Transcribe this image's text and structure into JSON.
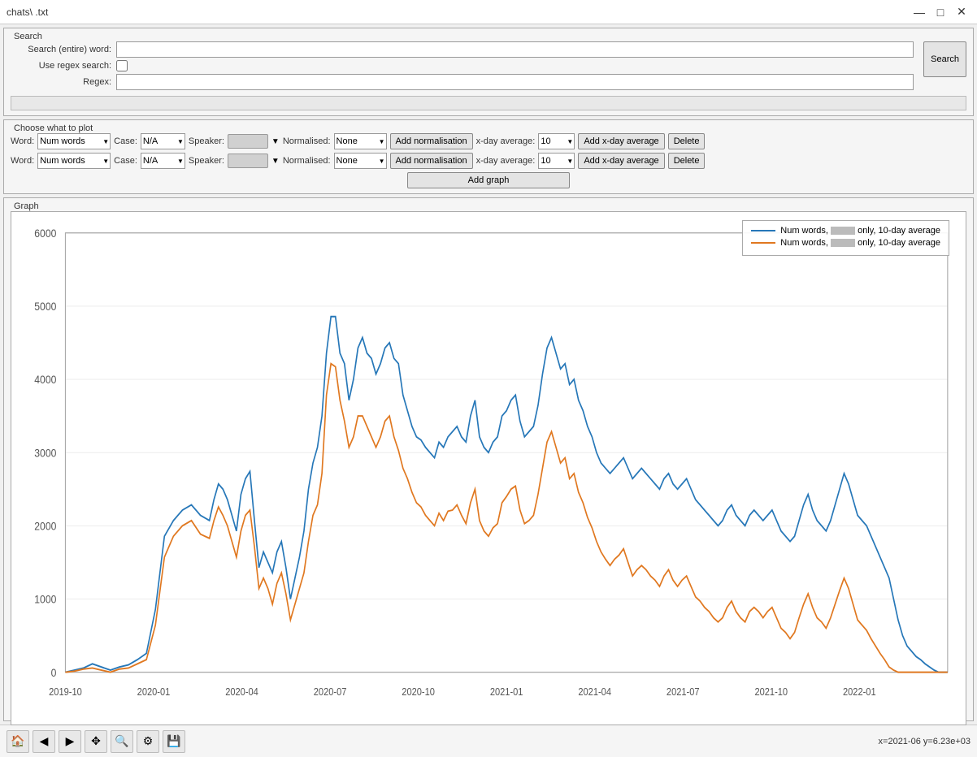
{
  "titlebar": {
    "title": "chats\\       .txt",
    "minimize_label": "—",
    "maximize_label": "□",
    "close_label": "✕"
  },
  "search": {
    "legend": "Search",
    "word_label": "Search (entire) word:",
    "word_value": "",
    "word_placeholder": "",
    "regex_label": "Use regex search:",
    "regex_label2": "Regex:",
    "regex_value": "",
    "button_label": "Search"
  },
  "plot": {
    "legend": "Choose what to plot",
    "rows": [
      {
        "word_label": "Word:",
        "word_value": "Num words",
        "case_label": "Case:",
        "case_value": "N/A",
        "speaker_label": "Speaker:",
        "speaker_value": "",
        "norm_label": "Normalised:",
        "norm_value": "None",
        "add_norm_label": "Add normalisation",
        "xday_label": "x-day average:",
        "xday_value": "10",
        "add_xday_label": "Add x-day average",
        "delete_label": "Delete"
      },
      {
        "word_label": "Word:",
        "word_value": "Num words",
        "case_label": "Case:",
        "case_value": "N/A",
        "speaker_label": "Speaker:",
        "speaker_value": "",
        "norm_label": "Normalised:",
        "norm_value": "None",
        "add_norm_label": "Add normalisation",
        "xday_label": "x-day average:",
        "xday_value": "10",
        "add_xday_label": "Add x-day average",
        "delete_label": "Delete"
      }
    ],
    "add_graph_label": "Add graph"
  },
  "graph": {
    "legend": "Graph",
    "y_labels": [
      "0",
      "1000",
      "2000",
      "3000",
      "4000",
      "5000",
      "6000"
    ],
    "x_labels": [
      "2019-10",
      "2020-01",
      "2020-04",
      "2020-07",
      "2020-10",
      "2021-01",
      "2021-04",
      "2021-07",
      "2021-10",
      "2022-01"
    ],
    "legend_items": [
      {
        "label": "Num words,        only, 10-day average",
        "color": "#2677b8"
      },
      {
        "label": "Num words,        only, 10-day average",
        "color": "#e07820"
      }
    ]
  },
  "toolbar": {
    "home_icon": "🏠",
    "back_icon": "←",
    "forward_icon": "→",
    "pan_icon": "✥",
    "zoom_icon": "🔍",
    "settings_icon": "≡",
    "save_icon": "💾",
    "status": "x=2021-06 y=6.23e+03"
  }
}
